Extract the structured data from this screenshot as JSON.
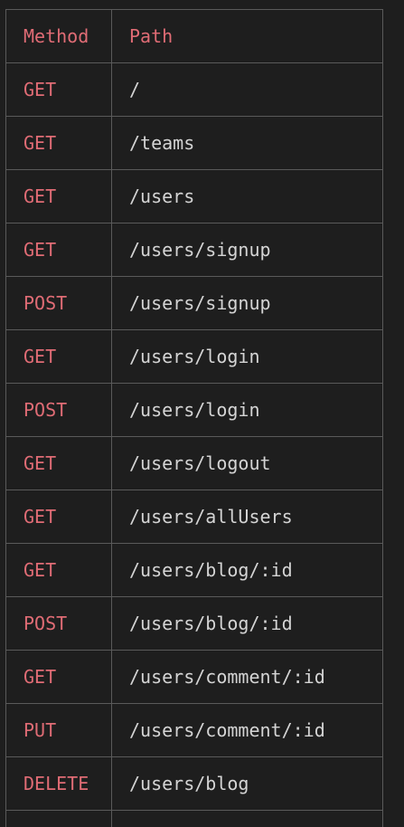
{
  "table": {
    "headers": {
      "method": "Method",
      "path": "Path"
    },
    "rows": [
      {
        "method": "GET",
        "path": "/"
      },
      {
        "method": "GET",
        "path": "/teams"
      },
      {
        "method": "GET",
        "path": "/users"
      },
      {
        "method": "GET",
        "path": "/users/signup"
      },
      {
        "method": "POST",
        "path": "/users/signup"
      },
      {
        "method": "GET",
        "path": "/users/login"
      },
      {
        "method": "POST",
        "path": "/users/login"
      },
      {
        "method": "GET",
        "path": "/users/logout"
      },
      {
        "method": "GET",
        "path": "/users/allUsers"
      },
      {
        "method": "GET",
        "path": "/users/blog/:id"
      },
      {
        "method": "POST",
        "path": "/users/blog/:id"
      },
      {
        "method": "GET",
        "path": "/users/comment/:id"
      },
      {
        "method": "PUT",
        "path": "/users/comment/:id"
      },
      {
        "method": "DELETE",
        "path": "/users/blog"
      },
      {
        "method": "",
        "path": ""
      }
    ]
  },
  "colors": {
    "background": "#1e1e1e",
    "method_text": "#e06c75",
    "path_text": "#d4d4d4",
    "border": "#5a5a5a"
  }
}
